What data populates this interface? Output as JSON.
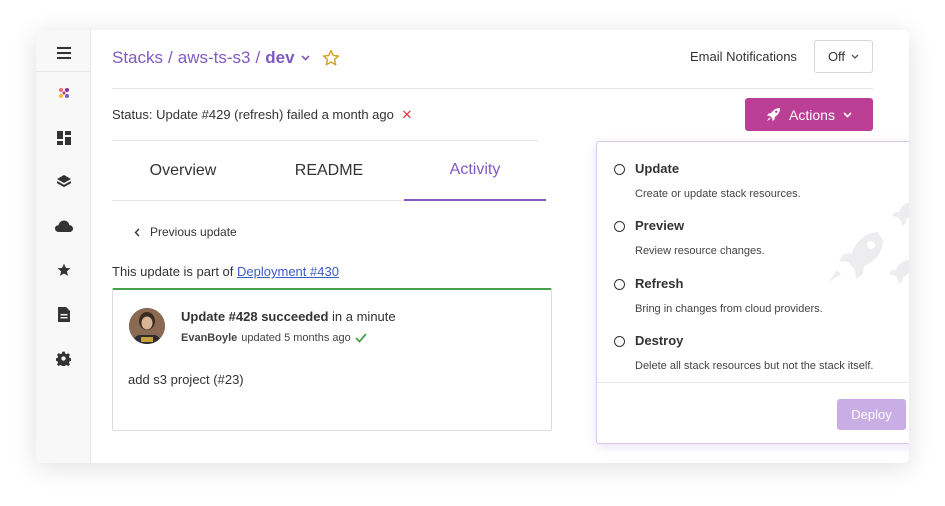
{
  "breadcrumb": {
    "stacks": "Stacks",
    "sep1": "/",
    "project": "aws-ts-s3",
    "sep2": "/",
    "stack": "dev"
  },
  "notifications": {
    "label": "Email Notifications",
    "value": "Off"
  },
  "status": {
    "label": "Status:",
    "text": "Update #429 (refresh) failed a month ago",
    "icon": "x-icon"
  },
  "actions": {
    "label": "Actions"
  },
  "tabs": [
    {
      "label": "Overview",
      "active": false
    },
    {
      "label": "README",
      "active": false
    },
    {
      "label": "Activity",
      "active": true
    }
  ],
  "previous_update": "Previous update",
  "deployment": {
    "prefix": "This update is part of",
    "link": "Deployment #430"
  },
  "update_card": {
    "title_bold": "Update #428 succeeded",
    "title_rest": "in a minute",
    "user": "EvanBoyle",
    "meta": "updated 5 months ago",
    "message": "add s3 project (#23)"
  },
  "action_menu": {
    "options": [
      {
        "title": "Update",
        "desc": "Create or update stack resources."
      },
      {
        "title": "Preview",
        "desc": "Review resource changes."
      },
      {
        "title": "Refresh",
        "desc": "Bring in changes from cloud providers."
      },
      {
        "title": "Destroy",
        "desc": "Delete all stack resources but not the stack itself."
      }
    ],
    "deploy_label": "Deploy"
  },
  "colors": {
    "brand_purple": "#805ac3",
    "actions_magenta": "#bb3f95",
    "success_green": "#48a24b",
    "error_red": "#d23c3c",
    "deploy_disabled": "#c9aee6",
    "star_gold": "#d4a52a"
  },
  "icons": [
    "hamburger-icon",
    "pulumi-logo-icon",
    "dashboard-icon",
    "layers-icon",
    "cloud-icon",
    "star-icon",
    "document-icon",
    "gear-icon"
  ]
}
